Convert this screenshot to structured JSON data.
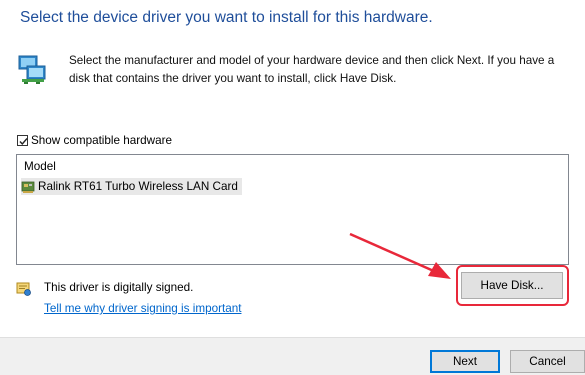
{
  "header": {
    "title": "Select the device driver you want to install for this hardware."
  },
  "instructions": {
    "icon": "network-adapter-icon",
    "text": "Select the manufacturer and model of your hardware device and then click Next. If you have a disk that contains the driver you want to install, click Have Disk."
  },
  "compatible": {
    "label": "Show compatible hardware",
    "checked": true
  },
  "model_list": {
    "header": "Model",
    "items": [
      {
        "label": "Ralink RT61 Turbo Wireless LAN Card",
        "icon": "network-card-icon",
        "selected": true
      }
    ]
  },
  "signature": {
    "icon": "signed-driver-icon",
    "text": "This driver is digitally signed.",
    "link": "Tell me why driver signing is important"
  },
  "buttons": {
    "have_disk": "Have Disk...",
    "next": "Next",
    "cancel": "Cancel"
  },
  "annotation": {
    "color": "#e8283a"
  }
}
